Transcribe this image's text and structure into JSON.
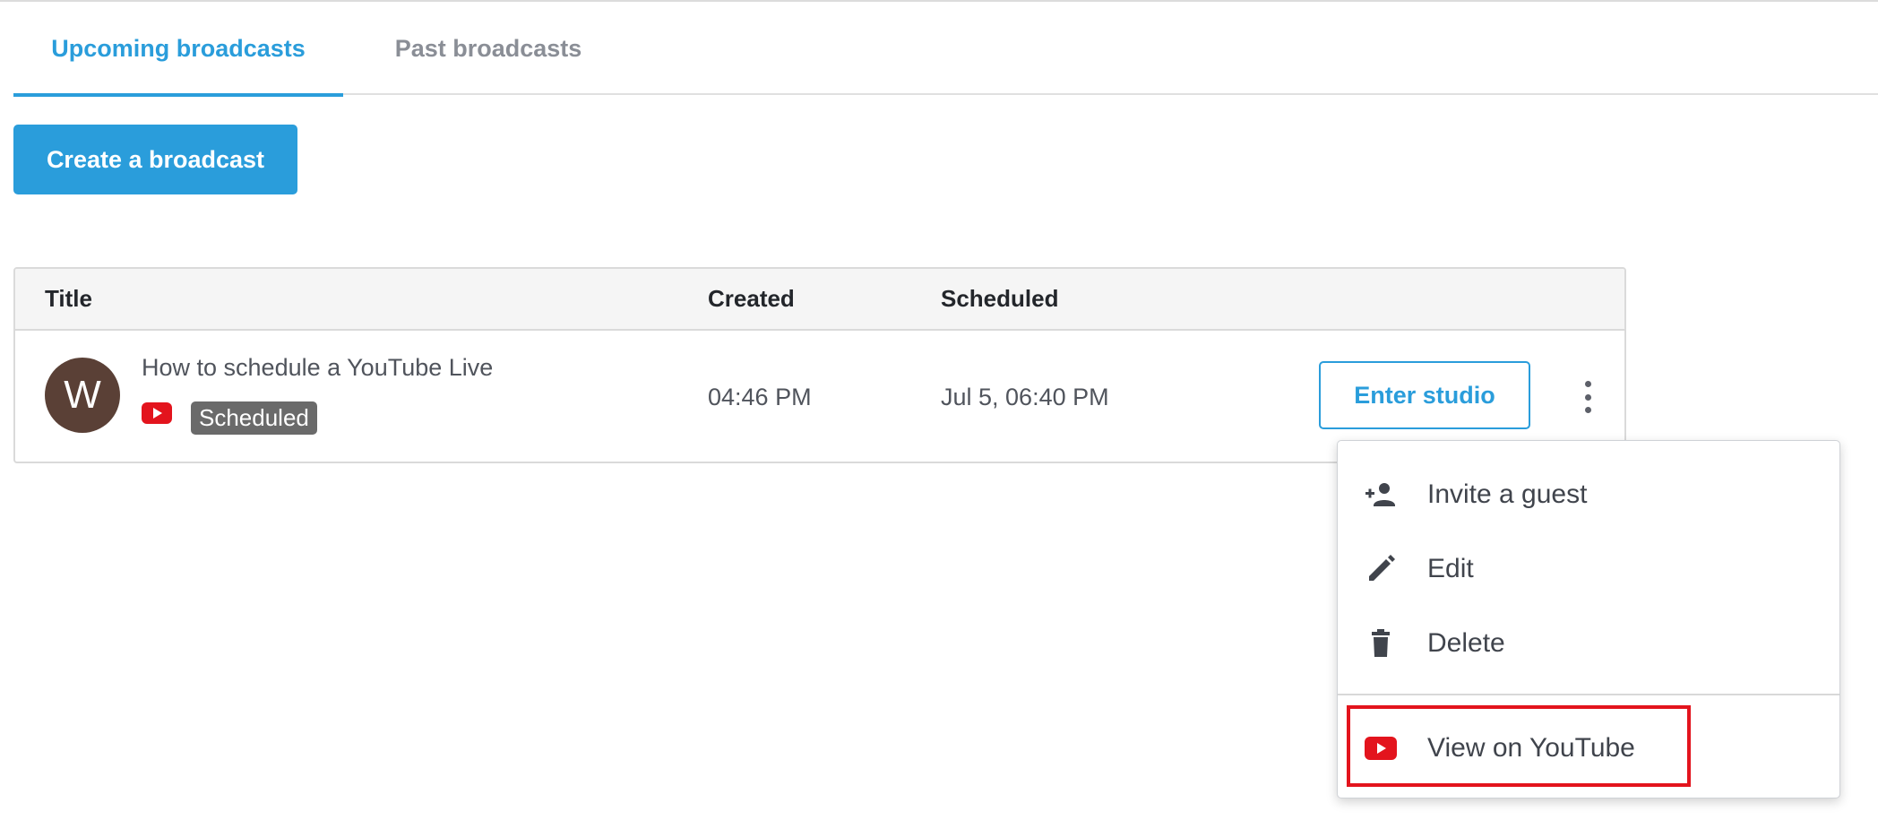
{
  "tabs": {
    "upcoming": "Upcoming broadcasts",
    "past": "Past broadcasts"
  },
  "actions": {
    "create_label": "Create a broadcast"
  },
  "table": {
    "headers": {
      "title": "Title",
      "created": "Created",
      "scheduled": "Scheduled"
    },
    "rows": [
      {
        "avatar_letter": "W",
        "title": "How to schedule a YouTube Live",
        "platform_icon": "youtube-icon",
        "status": "Scheduled",
        "created": "04:46 PM",
        "scheduled": "Jul 5, 06:40 PM",
        "enter_label": "Enter studio"
      }
    ]
  },
  "menu": {
    "items": [
      {
        "label": "Invite a guest",
        "icon": "add-person-icon"
      },
      {
        "label": "Edit",
        "icon": "pencil-icon"
      },
      {
        "label": "Delete",
        "icon": "trash-icon"
      },
      {
        "label": "View on YouTube",
        "icon": "youtube-icon"
      }
    ]
  },
  "colors": {
    "accent": "#2a9ddb",
    "youtube_red": "#e3141d",
    "avatar_bg": "#5a4036",
    "badge_bg": "#6a6a6a"
  }
}
